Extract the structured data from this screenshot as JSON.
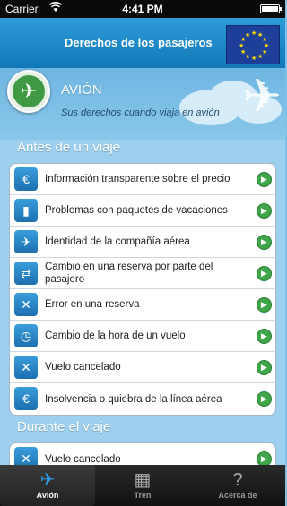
{
  "status_bar": {
    "carrier": "Carrier",
    "time": "4:41 PM"
  },
  "header": {
    "title": "Derechos de los pasajeros",
    "flag_icon": "eu-flag"
  },
  "hero": {
    "mode": "AVIÓN",
    "subtitle": "Sus derechos cuando viaja en avión",
    "icon": "airplane-icon"
  },
  "sections": [
    {
      "title": "Antes de un viaje",
      "items": [
        {
          "label": "Información transparente sobre el precio",
          "icon": "euro-icon",
          "glyph": "€"
        },
        {
          "label": "Problemas con paquetes de vacaciones",
          "icon": "holiday-package-icon",
          "glyph": "▮"
        },
        {
          "label": "Identidad de la compañía aérea",
          "icon": "airline-identity-icon",
          "glyph": "✈"
        },
        {
          "label": "Cambio en una reserva por parte del pasajero",
          "icon": "booking-change-icon",
          "glyph": "⇄"
        },
        {
          "label": "Error en una reserva",
          "icon": "booking-error-icon",
          "glyph": "✕"
        },
        {
          "label": "Cambio de la hora de un vuelo",
          "icon": "clock-icon",
          "glyph": "◷"
        },
        {
          "label": "Vuelo cancelado",
          "icon": "cancelled-flight-icon",
          "glyph": "✕"
        },
        {
          "label": "Insolvencia o quiebra de la línea aérea",
          "icon": "insolvency-icon",
          "glyph": "€"
        }
      ]
    },
    {
      "title": "Durante el viaje",
      "items": [
        {
          "label": "Vuelo cancelado",
          "icon": "cancelled-flight-icon",
          "glyph": "✕"
        }
      ]
    }
  ],
  "tabs": [
    {
      "label": "Avión",
      "icon": "airplane-icon",
      "glyph": "✈",
      "active": true
    },
    {
      "label": "Tren",
      "icon": "train-icon",
      "glyph": "▦",
      "active": false
    },
    {
      "label": "Acerca de",
      "icon": "question-icon",
      "glyph": "?",
      "active": false
    }
  ],
  "colors": {
    "header": "#1a86c6",
    "accent_green": "#3fa64a",
    "tab_active": "#2f9be4"
  }
}
